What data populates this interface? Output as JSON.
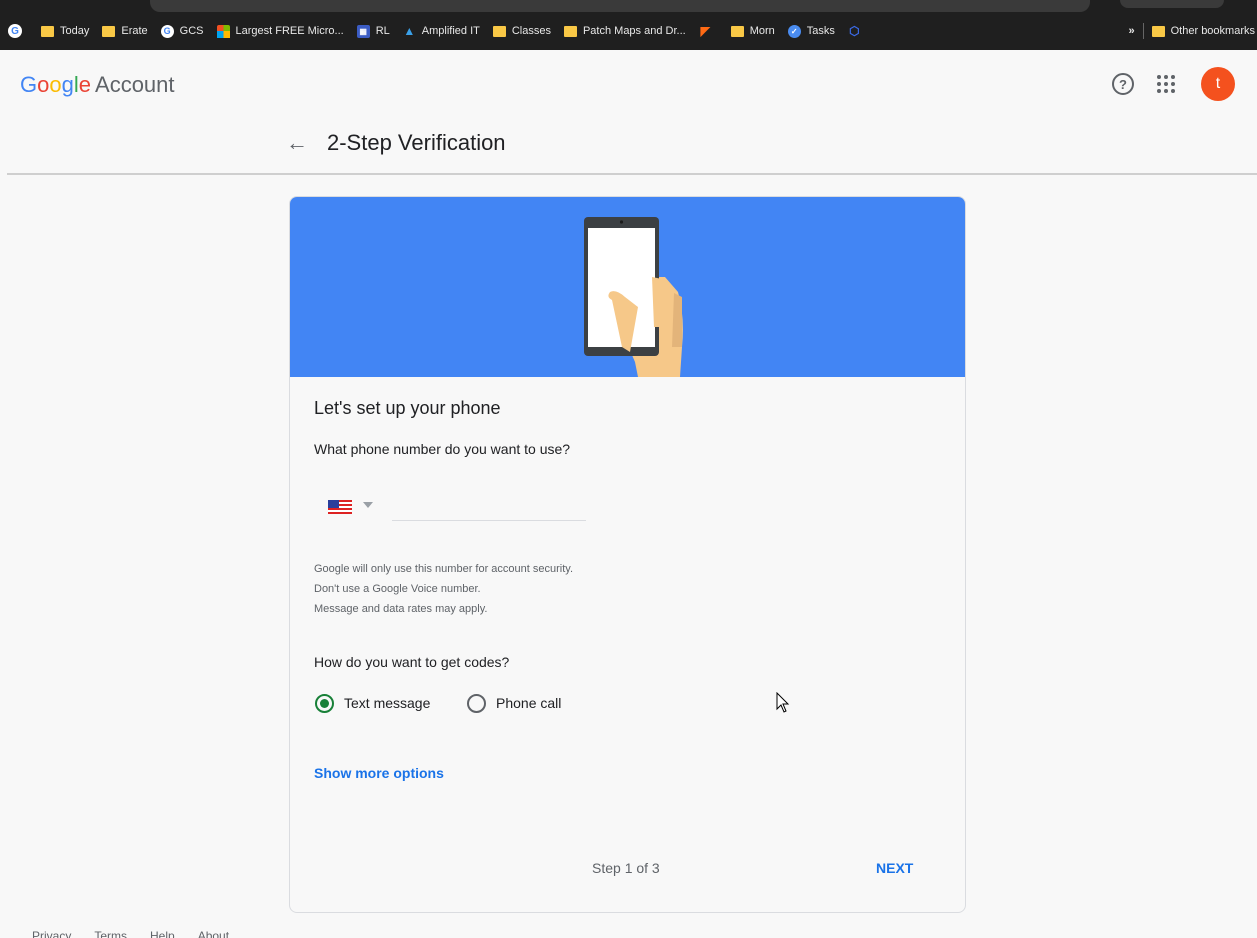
{
  "bookmarks": {
    "items": [
      {
        "label": "Today",
        "icon": "folder-icon"
      },
      {
        "label": "Erate",
        "icon": "folder-icon"
      },
      {
        "label": "GCS",
        "icon": "google-icon"
      },
      {
        "label": "Largest FREE Micro...",
        "icon": "microsoft-icon"
      },
      {
        "label": "RL",
        "icon": "rl-icon"
      },
      {
        "label": "Amplified IT",
        "icon": "amplified-icon"
      },
      {
        "label": "Classes",
        "icon": "folder-icon"
      },
      {
        "label": "Patch Maps and Dr...",
        "icon": "folder-icon"
      },
      {
        "label": "",
        "icon": "orange-app-icon"
      },
      {
        "label": "Morn",
        "icon": "folder-icon"
      },
      {
        "label": "Tasks",
        "icon": "tasks-icon"
      },
      {
        "label": "",
        "icon": "shield-icon"
      }
    ],
    "overflow": "»",
    "other": "Other bookmarks"
  },
  "header": {
    "logo_google": [
      "G",
      "o",
      "o",
      "g",
      "l",
      "e"
    ],
    "logo_account": "Account",
    "avatar_initial": "t",
    "help_glyph": "?",
    "back_glyph": "←",
    "title": "2-Step Verification"
  },
  "card": {
    "heading": "Let's set up your phone",
    "phone_question": "What phone number do you want to use?",
    "phone_value": "",
    "notes": [
      "Google will only use this number for account security.",
      "Don't use a Google Voice number.",
      "Message and data rates may apply."
    ],
    "codes_question": "How do you want to get codes?",
    "options": [
      {
        "label": "Text message",
        "selected": true
      },
      {
        "label": "Phone call",
        "selected": false
      }
    ],
    "more_options": "Show more options",
    "step": "Step 1 of 3",
    "next": "NEXT"
  },
  "footer": {
    "links": [
      "Privacy",
      "Terms",
      "Help",
      "About"
    ]
  },
  "colors": {
    "hero_blue": "#4285f4",
    "link_blue": "#1a73e8",
    "radio_green": "#188038",
    "avatar_orange": "#f4511e"
  }
}
